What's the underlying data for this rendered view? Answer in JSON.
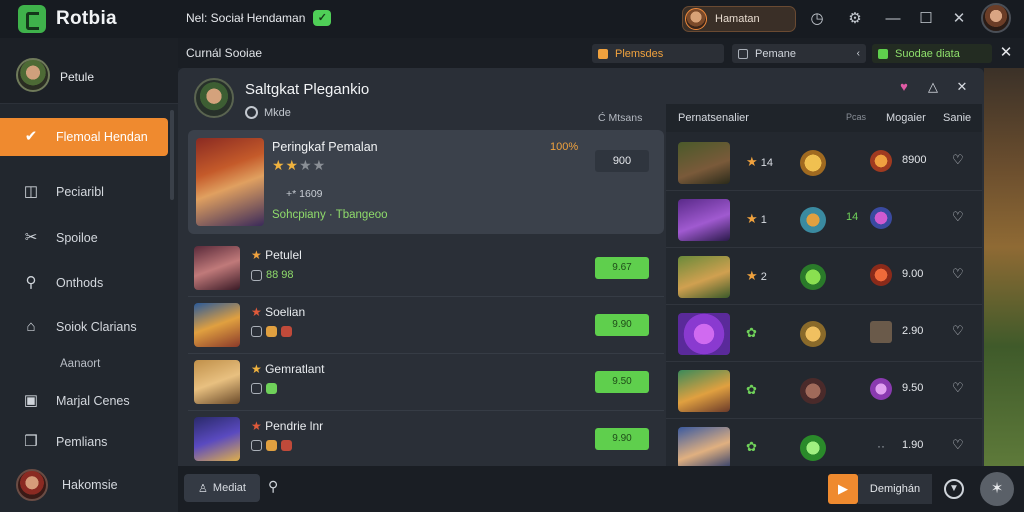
{
  "titlebar": {
    "app_name": "Rotbia",
    "status_text": "Nel: Sociał Hendaman",
    "user_name": "Hamatan",
    "icons": [
      "clock-icon",
      "gear-icon",
      "minimize-icon",
      "close-icon"
    ]
  },
  "sidebar": {
    "profile_name": "Petule",
    "items": [
      {
        "label": "Flemoal Hendan",
        "icon": "check-icon"
      },
      {
        "label": "Peciaribl",
        "icon": "tag-icon"
      },
      {
        "label": "Spoiloe",
        "icon": "tools-icon"
      },
      {
        "label": "Onthods",
        "icon": "search-icon"
      },
      {
        "label": "Soiok Clarians",
        "icon": "home-icon"
      },
      {
        "label": "Marjal Cenes",
        "icon": "folder-icon"
      },
      {
        "label": "Pemlians",
        "icon": "cube-icon"
      },
      {
        "label": "Hakomsie",
        "icon": "avatar"
      }
    ],
    "section_label": "Aanaort"
  },
  "subheader": {
    "title": "Curnál Sooiae",
    "chip1": "Plemsdes",
    "chip2": "Pemane",
    "chip3": "Suodae diata"
  },
  "main": {
    "title": "Saltgkat Plegankio",
    "subtitle": "Mkde",
    "right_label": "Ć Mtsans",
    "featured": {
      "name": "Peringkaf Pemalan",
      "percent": "100%",
      "meta": "+* 1609",
      "category": "Sohcpiany · Tbangeoo",
      "amount": "900"
    },
    "rows": [
      {
        "name": "Petulel",
        "sub": "88 98",
        "btn": "9.67"
      },
      {
        "name": "Soelian",
        "sub": "",
        "btn": "9.90"
      },
      {
        "name": "Gemratlant",
        "sub": "",
        "btn": "9.50"
      },
      {
        "name": "Pendrie lnr",
        "sub": "",
        "btn": "9.90"
      }
    ]
  },
  "table": {
    "header": {
      "col1": "Pernatsenalier",
      "col2": "Pcas",
      "col3": "Mogaier",
      "col4": "Sanie"
    },
    "rows": [
      {
        "rank": "14",
        "rank_icon": "star",
        "mid": "",
        "value": "8900"
      },
      {
        "rank": "1",
        "rank_icon": "star",
        "mid": "14",
        "value": ""
      },
      {
        "rank": "2",
        "rank_icon": "star",
        "mid": "",
        "value": "9.00"
      },
      {
        "rank": "",
        "rank_icon": "leaf",
        "mid": "",
        "value": "2.90"
      },
      {
        "rank": "",
        "rank_icon": "leaf",
        "mid": "",
        "value": "9.50"
      },
      {
        "rank": "",
        "rank_icon": "leaf",
        "mid": "",
        "value": "1.90"
      }
    ]
  },
  "bottom": {
    "left_button": "Mediat",
    "right_label": "Demighán"
  },
  "colors": {
    "accent": "#ef8a2f",
    "green": "#5fcf4d",
    "bg": "#1d2229"
  }
}
